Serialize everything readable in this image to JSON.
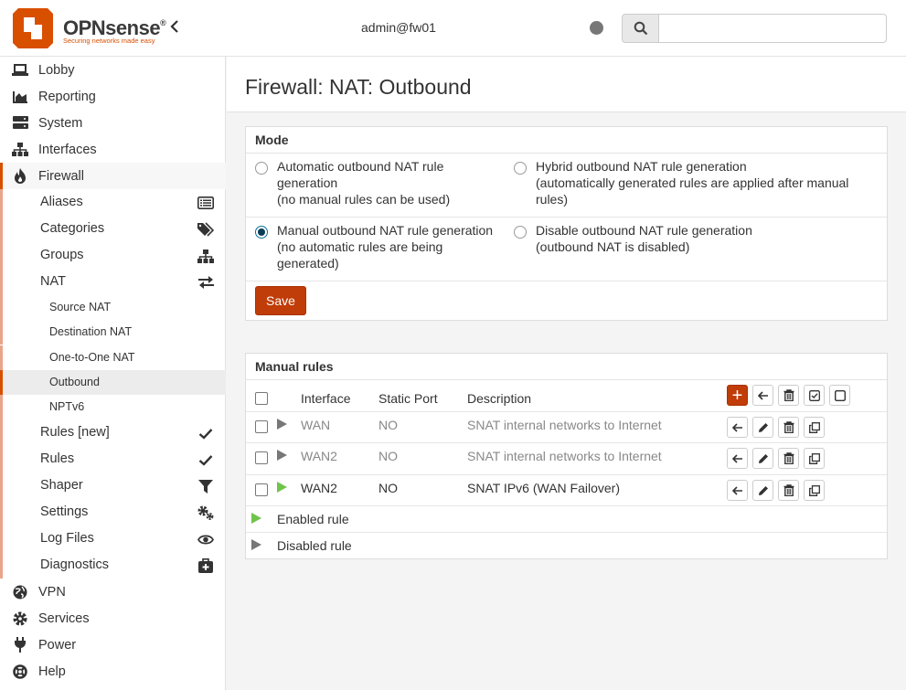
{
  "header": {
    "brand": "OPNsense",
    "brand_mark": "®",
    "tagline": "Securing networks made easy",
    "user": "admin@fw01",
    "search_placeholder": ""
  },
  "sidebar": {
    "top": [
      {
        "label": "Lobby",
        "icon": "laptop-icon"
      },
      {
        "label": "Reporting",
        "icon": "area-chart-icon"
      },
      {
        "label": "System",
        "icon": "server-icon"
      },
      {
        "label": "Interfaces",
        "icon": "sitemap-icon"
      },
      {
        "label": "Firewall",
        "icon": "fire-icon"
      }
    ],
    "firewall_sub": [
      {
        "label": "Aliases",
        "icon": "list-icon"
      },
      {
        "label": "Categories",
        "icon": "tags-icon"
      },
      {
        "label": "Groups",
        "icon": "sitemap-icon"
      },
      {
        "label": "NAT",
        "icon": "exchange-icon"
      }
    ],
    "nat_sub": [
      {
        "label": "Source NAT"
      },
      {
        "label": "Destination NAT"
      },
      {
        "label": "One-to-One NAT"
      },
      {
        "label": "Outbound"
      },
      {
        "label": "NPTv6"
      }
    ],
    "firewall_sub2": [
      {
        "label": "Rules [new]",
        "icon": "check-icon"
      },
      {
        "label": "Rules",
        "icon": "check-icon"
      },
      {
        "label": "Shaper",
        "icon": "filter-icon"
      },
      {
        "label": "Settings",
        "icon": "cogs-icon"
      },
      {
        "label": "Log Files",
        "icon": "eye-icon"
      },
      {
        "label": "Diagnostics",
        "icon": "medkit-icon"
      }
    ],
    "bottom": [
      {
        "label": "VPN",
        "icon": "globe-icon"
      },
      {
        "label": "Services",
        "icon": "cog-icon"
      },
      {
        "label": "Power",
        "icon": "plug-icon"
      },
      {
        "label": "Help",
        "icon": "life-ring-icon"
      }
    ]
  },
  "page": {
    "title": "Firewall: NAT: Outbound"
  },
  "mode": {
    "heading": "Mode",
    "options": [
      {
        "line1": "Automatic outbound NAT rule",
        "line2": "generation",
        "line3": "(no manual rules can be used)",
        "checked": false
      },
      {
        "line1": "Hybrid outbound NAT rule generation",
        "line2": "(automatically generated rules are applied after manual",
        "line3": "rules)",
        "checked": false
      },
      {
        "line1": "Manual outbound NAT rule generation",
        "line2": "(no automatic rules are being",
        "line3": "generated)",
        "checked": true
      },
      {
        "line1": "Disable outbound NAT rule generation",
        "line2": "(outbound NAT is disabled)",
        "line3": "",
        "checked": false
      }
    ],
    "save_label": "Save"
  },
  "rules": {
    "heading": "Manual rules",
    "columns": [
      "Interface",
      "Static Port",
      "Description"
    ],
    "rows": [
      {
        "interface": "WAN",
        "static_port": "NO",
        "description": "SNAT internal networks to Internet",
        "enabled": false
      },
      {
        "interface": "WAN2",
        "static_port": "NO",
        "description": "SNAT internal networks to Internet",
        "enabled": false
      },
      {
        "interface": "WAN2",
        "static_port": "NO",
        "description": "SNAT IPv6 (WAN Failover)",
        "enabled": true
      }
    ],
    "legend_enabled": "Enabled rule",
    "legend_disabled": "Disabled rule",
    "add_symbol": "+"
  },
  "colors": {
    "accent": "#d94f00",
    "button": "#c03c08",
    "enabled": "#6fc44a",
    "disabled": "#777777"
  }
}
